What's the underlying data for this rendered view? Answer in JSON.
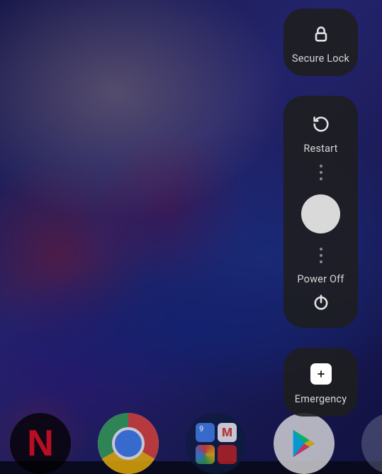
{
  "power_menu": {
    "secure_lock": {
      "label": "Secure Lock",
      "icon": "lock-icon"
    },
    "restart": {
      "label": "Restart",
      "icon": "restart-icon"
    },
    "power_off": {
      "label": "Power Off",
      "icon": "power-icon"
    },
    "emergency": {
      "label": "Emergency",
      "icon": "plus-icon"
    }
  },
  "dock": {
    "apps": [
      "Netflix",
      "Chrome",
      "Google Folder",
      "Play Store",
      "App"
    ]
  }
}
